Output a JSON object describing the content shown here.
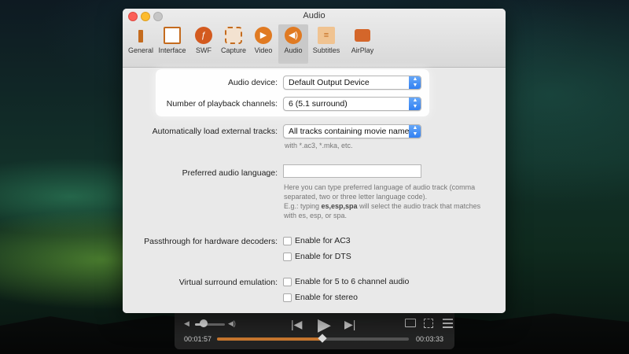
{
  "window": {
    "title": "Audio"
  },
  "tabs": [
    {
      "label": "General",
      "icon": "general-icon"
    },
    {
      "label": "Interface",
      "icon": "interface-icon"
    },
    {
      "label": "SWF",
      "icon": "swf-icon"
    },
    {
      "label": "Capture",
      "icon": "capture-icon"
    },
    {
      "label": "Video",
      "icon": "video-icon"
    },
    {
      "label": "Audio",
      "icon": "audio-icon"
    },
    {
      "label": "Subtitles",
      "icon": "subtitles-icon"
    },
    {
      "label": "AirPlay",
      "icon": "airplay-icon"
    }
  ],
  "audio_device": {
    "label": "Audio device:",
    "value": "Default Output Device"
  },
  "channels": {
    "label": "Number of playback channels:",
    "value": "6 (5.1 surround)"
  },
  "external_tracks": {
    "label": "Automatically load external tracks:",
    "value": "All tracks containing movie name",
    "help": "with *.ac3, *.mka, etc."
  },
  "preferred_language": {
    "label": "Preferred audio language:",
    "value": "",
    "help1": "Here you can type preferred language of audio track (comma",
    "help2": "separated, two or three letter language code).",
    "help3_prefix": "E.g.: typing ",
    "help3_bold": "es,esp,spa",
    "help3_suffix": " will select the audio track that matches",
    "help4": "with es, esp, or spa."
  },
  "passthrough": {
    "label": "Passthrough for hardware decoders:",
    "ac3": "Enable for AC3",
    "dts": "Enable for DTS"
  },
  "virtual_surround": {
    "label": "Virtual surround emulation:",
    "five_to_six": "Enable for 5 to 6 channel audio",
    "stereo": "Enable for stereo"
  },
  "player": {
    "time_current": "00:01:57",
    "time_total": "00:03:33",
    "progress": 0.55,
    "volume": 0.25
  },
  "colors": {
    "accent_blue": "#2f7ef2",
    "seek_orange": "#c9782f",
    "close": "#fc5f57",
    "minimize": "#fdbc2e"
  }
}
